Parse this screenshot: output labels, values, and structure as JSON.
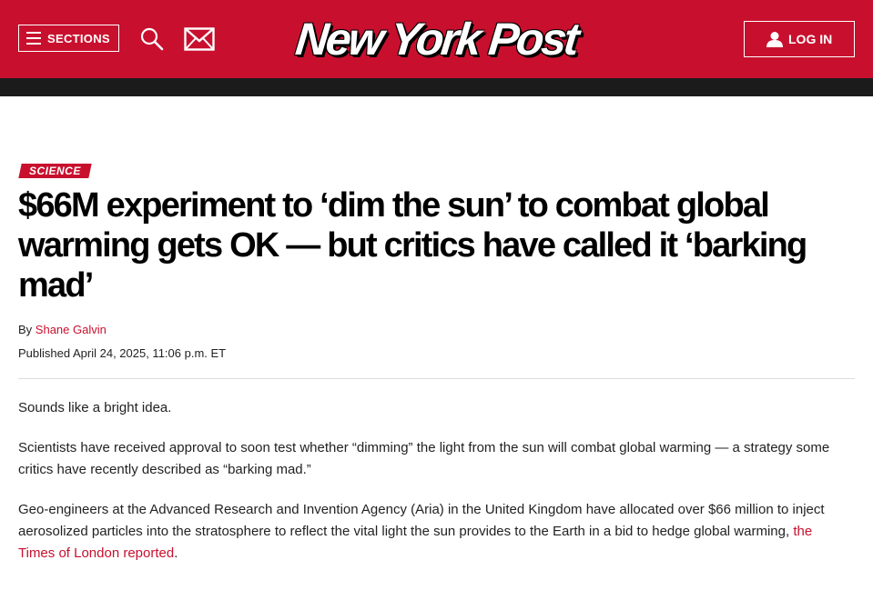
{
  "header": {
    "sections_label": "SECTIONS",
    "logo_text": "New York Post",
    "login_label": "LOG IN",
    "brand_color": "#c8102e",
    "icons": [
      "menu-icon",
      "search-icon",
      "mail-icon",
      "user-icon"
    ]
  },
  "article": {
    "kicker": "SCIENCE",
    "headline": "$66M experiment to ‘dim the sun’ to combat global warming gets OK — but critics have called it ‘barking mad’",
    "byline_prefix": "By",
    "author": "Shane Galvin",
    "published": "Published April 24, 2025, 11:06 p.m. ET",
    "p1": "Sounds like a bright idea.",
    "p2": "Scientists have received approval to soon test whether “dimming” the light from the sun will combat global warming — a strategy some critics have recently described as “barking mad.”",
    "p3_text": "Geo-engineers at the Advanced Research and Invention Agency (Aria) in the United Kingdom have allocated over $66 million to inject aerosolized particles into the stratosphere to reflect the vital light the sun provides to the Earth in a bid to hedge global warming, ",
    "p3_link": "the Times of London reported",
    "p3_end": "."
  }
}
